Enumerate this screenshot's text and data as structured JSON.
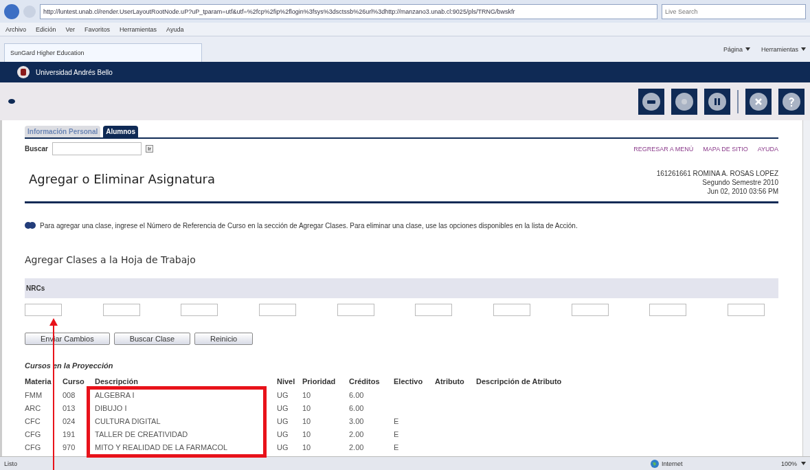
{
  "browser": {
    "address": "http://luntest.unab.cl/render.UserLayoutRootNode.uP?uP_tparam=utf&utf=%2fcp%2fip%2flogin%3fsys%3dsctssb%26url%3dhttp://manzano3.unab.cl:9025/pls/TRNG/bwskfr",
    "search_placeholder": "Live Search",
    "menu": [
      "Archivo",
      "Edición",
      "Ver",
      "Favoritos",
      "Herramientas",
      "Ayuda"
    ],
    "tab_title": "SunGard Higher Education",
    "toolbar": [
      "Página",
      "Herramientas"
    ]
  },
  "banner": {
    "title": "Universidad Andrés Bello"
  },
  "tabs": [
    {
      "label": "Información Personal",
      "selected": false
    },
    {
      "label": "Alumnos",
      "selected": true
    }
  ],
  "search": {
    "label": "Buscar",
    "button": "Ir"
  },
  "links": [
    "REGRESAR A MENÚ",
    "MAPA DE SITIO",
    "AYUDA"
  ],
  "page_title": "Agregar o Eliminar Asignatura",
  "user_info": [
    "161261661 ROMINA A. ROSAS LOPEZ",
    "Segundo Semestre 2010",
    "Jun 02, 2010 03:56 PM"
  ],
  "info_text": "Para agregar una clase, ingrese el Número de Referencia de Curso en la sección de Agregar Clases. Para eliminar una clase, use las opciones disponibles en la lista de Acción.",
  "add_section": {
    "title": "Agregar Clases a la Hoja de Trabajo",
    "band_label": "NRCs"
  },
  "buttons": [
    "Enviar Cambios",
    "Buscar Clase",
    "Reinicio"
  ],
  "projection": {
    "title": "Cursos en la Proyección",
    "columns": [
      "Materia",
      "Curso",
      "Descripción",
      "Nivel",
      "Prioridad",
      "Créditos",
      "Electivo",
      "Atributo",
      "Descripción de Atributo"
    ],
    "rows": [
      [
        "FMM",
        "008",
        "ALGEBRA I",
        "UG",
        "10",
        "6.00",
        "",
        "",
        ""
      ],
      [
        "ARC",
        "013",
        "DIBUJO I",
        "UG",
        "10",
        "6.00",
        "",
        "",
        ""
      ],
      [
        "CFC",
        "024",
        "CULTURA DIGITAL",
        "UG",
        "10",
        "3.00",
        "E",
        "",
        ""
      ],
      [
        "CFG",
        "191",
        "TALLER DE CREATIVIDAD",
        "UG",
        "10",
        "2.00",
        "E",
        "",
        ""
      ],
      [
        "CFG",
        "970",
        "MITO Y REALIDAD DE LA FARMACOL",
        "UG",
        "10",
        "2.00",
        "E",
        "",
        ""
      ]
    ]
  },
  "status_bar": {
    "text": "Listo",
    "zone": "Internet",
    "zoom": "100%"
  }
}
